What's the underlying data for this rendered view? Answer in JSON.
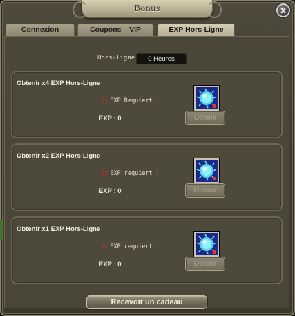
{
  "window": {
    "title": "Bonus",
    "close_label": "x"
  },
  "tabs": [
    {
      "label": "Connexion",
      "active": false
    },
    {
      "label": "Coupons – VIP",
      "active": false
    },
    {
      "label": "EXP Hors-Ligne",
      "active": true
    }
  ],
  "offline": {
    "label": "Hors-ligne",
    "value": "0 Heures"
  },
  "panels": [
    {
      "title": "Obtenir x4 EXP Hors-Ligne",
      "req_num": "1x",
      "req_text": "EXP Requiert :",
      "exp_text": "EXP : 0",
      "button": "Obtenir",
      "icon": "blue-orb-item-icon"
    },
    {
      "title": "Obtenir x2 EXP Hors-Ligne",
      "req_num": "1x",
      "req_text": "EXP requiert :",
      "exp_text": "EXP : 0",
      "button": "Obtenir",
      "icon": "blue-orb-item-icon"
    },
    {
      "title": "Obtenir x1 EXP Hors-Ligne",
      "req_num": "1x",
      "req_text": "EXP requiert :",
      "exp_text": "EXP : 0",
      "button": "Obtenir",
      "icon": "blue-orb-item-icon"
    }
  ],
  "footer": {
    "receive_button": "Recevoir un cadeau"
  },
  "colors": {
    "panel_bg": "#4d4a3b",
    "accent_red": "#d22a1e",
    "item_bg": "#1b2a8a"
  }
}
